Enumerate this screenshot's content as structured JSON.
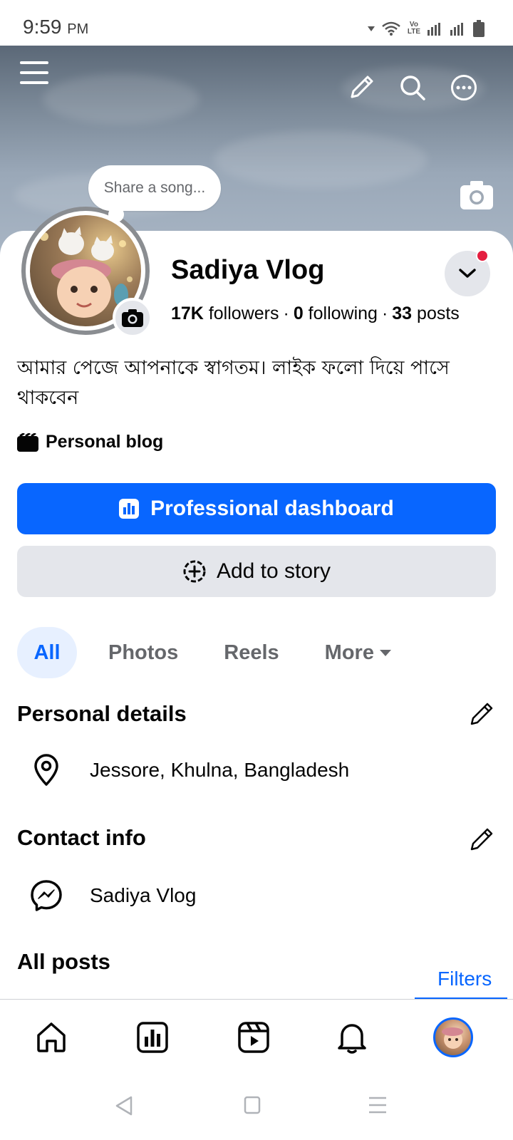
{
  "status_bar": {
    "time": "9:59",
    "ampm": "PM",
    "network_label_top": "Vo",
    "network_label_bottom": "LTE"
  },
  "cover": {
    "icons": [
      "menu-icon",
      "edit-icon",
      "search-icon",
      "more-icon",
      "camera-icon"
    ]
  },
  "profile": {
    "share_song_placeholder": "Share a song...",
    "name": "Sadiya Vlog",
    "followers_count": "17K",
    "followers_label": "followers",
    "following_count": "0",
    "following_label": "following",
    "posts_count": "33",
    "posts_label": "posts",
    "bio": "আমার পেজে আপনাকে স্বাগতম। লাইক ফলো দিয়ে পাসে থাকবেন",
    "category": "Personal blog"
  },
  "actions": {
    "primary_label": "Professional dashboard",
    "secondary_label": "Add to story"
  },
  "tabs": [
    {
      "label": "All",
      "active": true
    },
    {
      "label": "Photos",
      "active": false
    },
    {
      "label": "Reels",
      "active": false
    },
    {
      "label": "More",
      "active": false
    }
  ],
  "personal_details": {
    "title": "Personal details",
    "location": "Jessore, Khulna, Bangladesh"
  },
  "contact_info": {
    "title": "Contact info",
    "messenger": "Sadiya Vlog"
  },
  "posts": {
    "title": "All posts",
    "filters_label": "Filters"
  },
  "bottom_nav": [
    "home-icon",
    "dashboard-icon",
    "reels-icon",
    "notifications-icon",
    "profile-avatar"
  ],
  "colors": {
    "accent": "#0866ff",
    "notification_dot": "#e41e3f",
    "secondary_button": "#e4e6eb"
  }
}
